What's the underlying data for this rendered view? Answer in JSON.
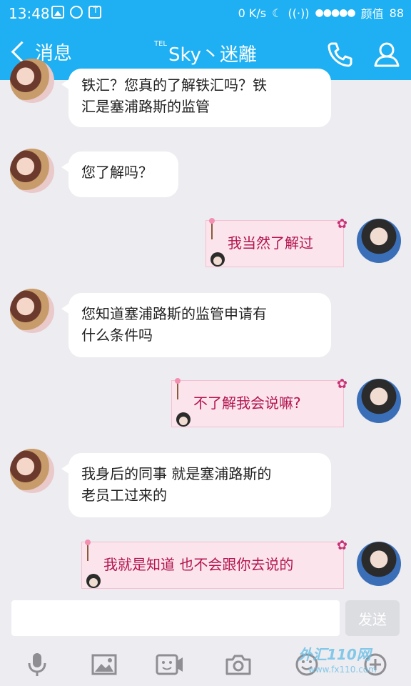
{
  "status": {
    "time": "13:48",
    "speed": "0 K/s",
    "carrier": "颜值",
    "battery": "88",
    "dots": "●●●●●"
  },
  "nav": {
    "back_label": "消息",
    "title_prefix": "TEL",
    "title": "Sky丶迷離"
  },
  "messages": [
    {
      "side": "left",
      "text_line1": "铁汇？您真的了解铁汇吗？铁",
      "text_line2": "汇是塞浦路斯的监管"
    },
    {
      "side": "left",
      "text": "您了解吗？"
    },
    {
      "side": "right",
      "text": "我当然了解过"
    },
    {
      "side": "left",
      "text_line1": "您知道塞浦路斯的监管申请有",
      "text_line2": "什么条件吗"
    },
    {
      "side": "right",
      "text": "不了解我会说嘛?"
    },
    {
      "side": "left",
      "text_line1": "我身后的同事 就是塞浦路斯的",
      "text_line2": "老员工过来的"
    },
    {
      "side": "right",
      "text": "我就是知道 也不会跟你去说的"
    }
  ],
  "input": {
    "send_label": "发送"
  },
  "toolbar": {
    "icons": [
      "mic-icon",
      "image-icon",
      "video-icon",
      "camera-icon",
      "emoji-icon",
      "plus-icon"
    ]
  },
  "watermark": {
    "text": "外汇110网",
    "url": "www.fx110.com"
  },
  "colors": {
    "accent": "#1eb0f2",
    "right_bubble": "#fce4ec",
    "right_text": "#b3154f"
  }
}
